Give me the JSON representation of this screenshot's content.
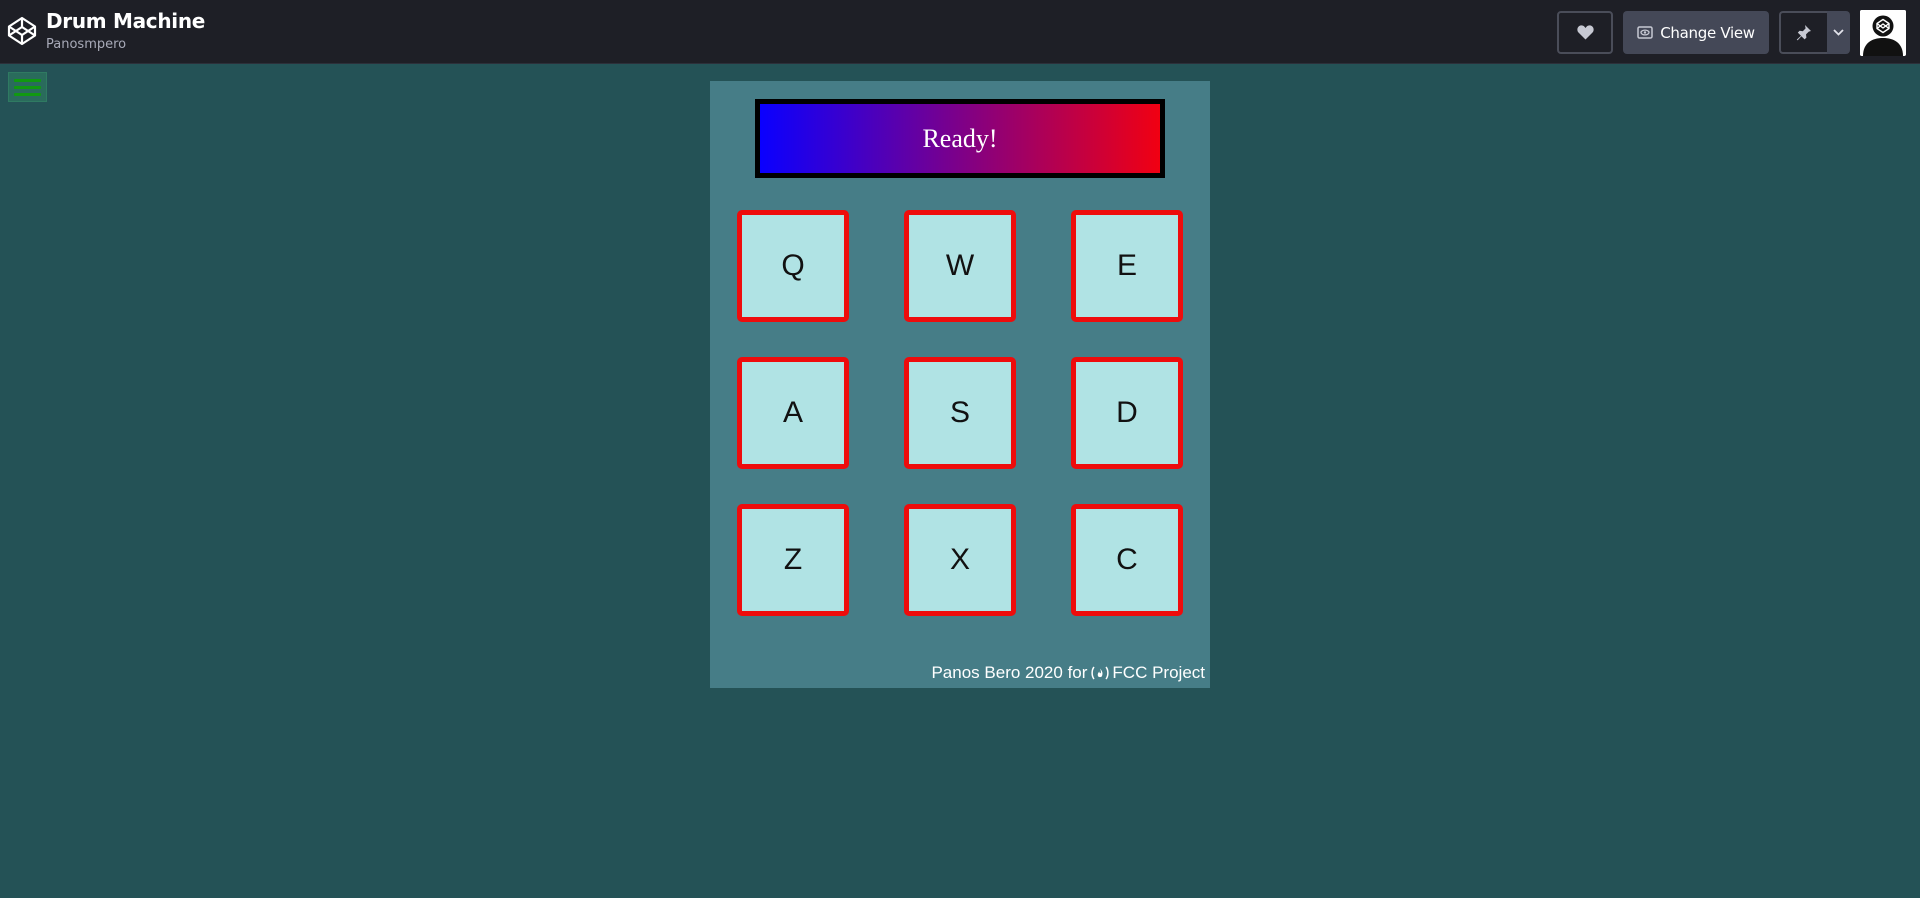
{
  "header": {
    "title": "Drum Machine",
    "author": "Panosmpero",
    "change_view_label": "Change View"
  },
  "icons": {
    "logo": "codepen-logo-icon",
    "heart": "heart-icon",
    "change_view": "eye-icon",
    "pin": "pin-icon",
    "caret": "chevron-down-icon",
    "avatar": "user-avatar-icon",
    "menu": "hamburger-menu-icon",
    "fcc": "freecodecamp-icon"
  },
  "display": {
    "text": "Ready!"
  },
  "pads": [
    {
      "key": "Q"
    },
    {
      "key": "W"
    },
    {
      "key": "E"
    },
    {
      "key": "A"
    },
    {
      "key": "S"
    },
    {
      "key": "D"
    },
    {
      "key": "Z"
    },
    {
      "key": "X"
    },
    {
      "key": "C"
    }
  ],
  "footer": {
    "text": "Panos Bero 2020 for",
    "project": "FCC Project"
  },
  "colors": {
    "page_bg": "#245256",
    "machine_bg": "#467d87",
    "pad_bg": "#b0e3e4",
    "pad_border": "#ee0c0c",
    "display_gradient_start": "#0a00ff",
    "display_gradient_end": "#f10012"
  }
}
